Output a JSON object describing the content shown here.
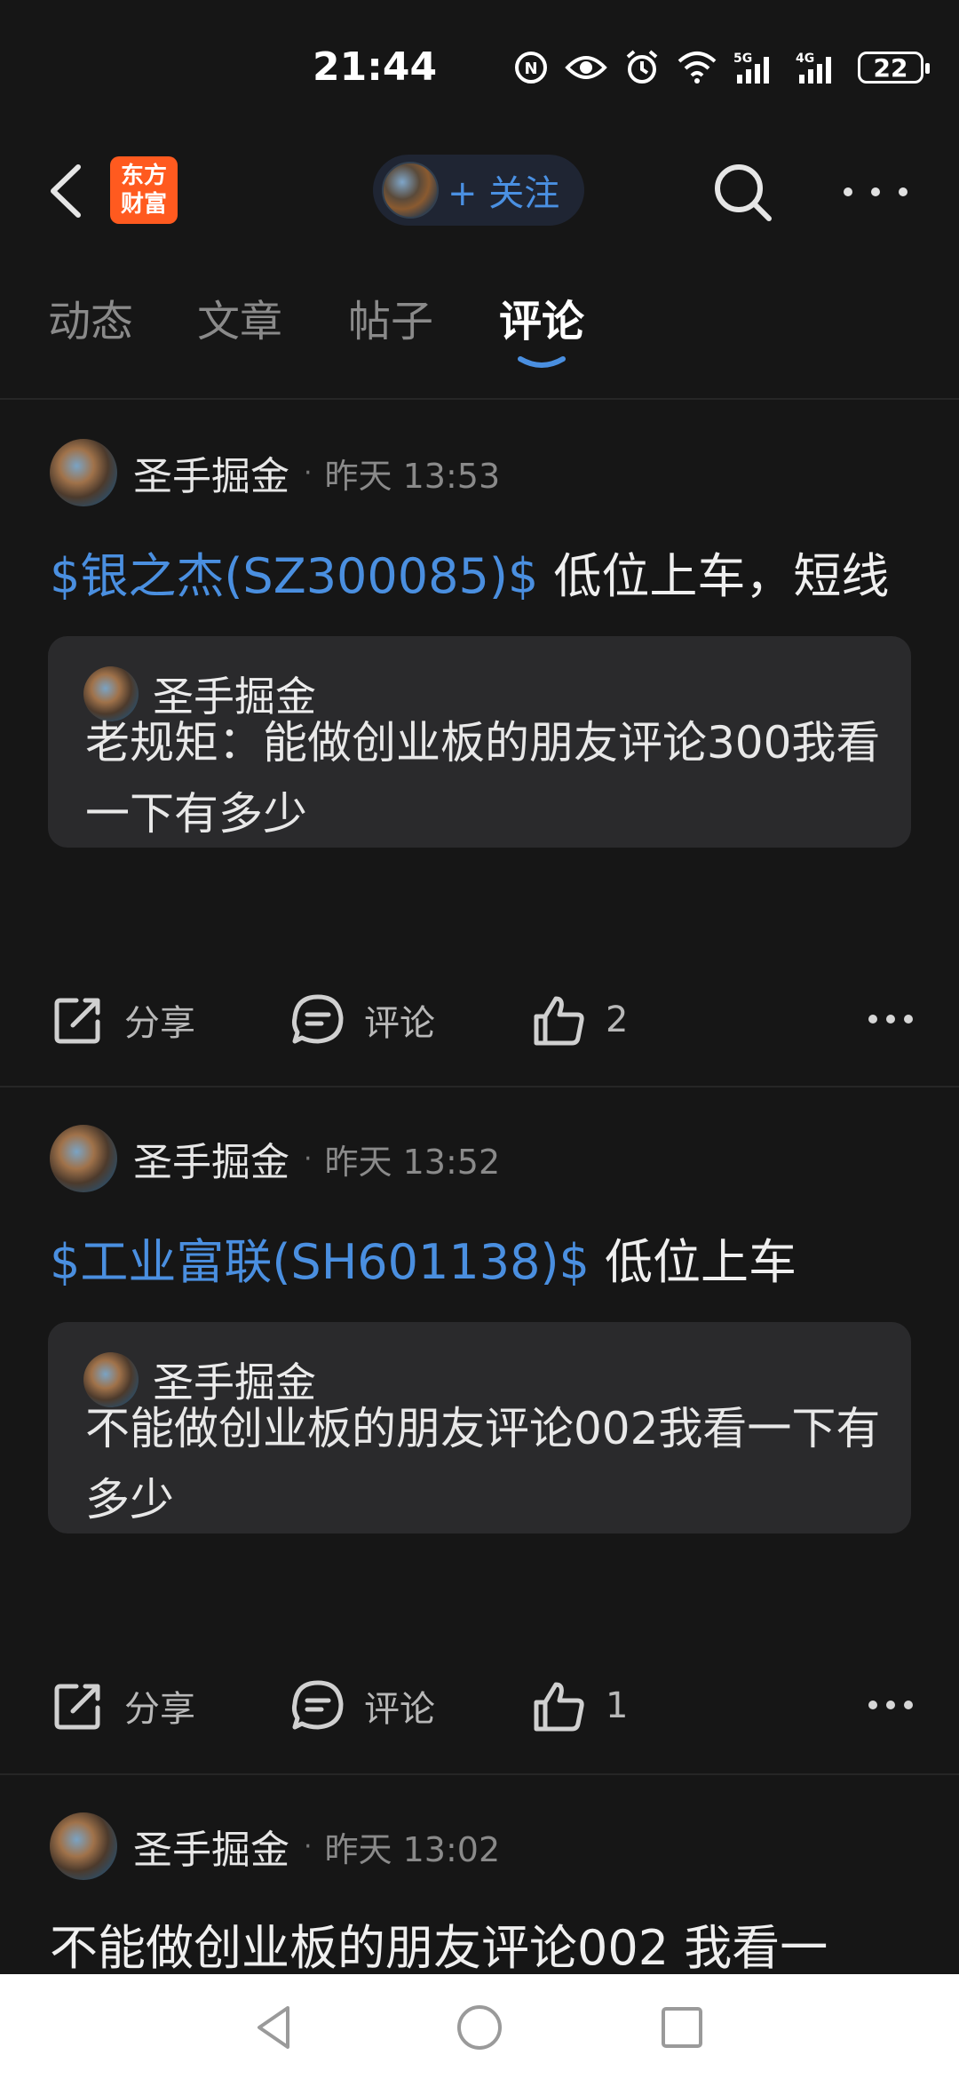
{
  "status": {
    "time": "21:44",
    "battery": "22",
    "net1": "5G",
    "net2": "4G"
  },
  "header": {
    "logo_text_line1": "东方",
    "logo_text_line2": "财富",
    "follow_label": "+ 关注"
  },
  "tabs": [
    {
      "label": "动态"
    },
    {
      "label": "文章"
    },
    {
      "label": "帖子"
    },
    {
      "label": "评论"
    }
  ],
  "active_tab": "评论",
  "posts": [
    {
      "author": "圣手掘金",
      "time": "昨天 13:53",
      "stock": "$银之杰(SZ300085)$",
      "text": " 低位上车，短线",
      "quote_author": "圣手掘金",
      "quote_text": "老规矩：能做创业板的朋友评论300我看一下有多少",
      "share_label": "分享",
      "comment_label": "评论",
      "like_count": "2"
    },
    {
      "author": "圣手掘金",
      "time": "昨天 13:52",
      "stock": "$工业富联(SH601138)$",
      "text": " 低位上车",
      "quote_author": "圣手掘金",
      "quote_text": "不能做创业板的朋友评论002我看一下有多少",
      "share_label": "分享",
      "comment_label": "评论",
      "like_count": "1"
    },
    {
      "author": "圣手掘金",
      "time": "昨天 13:02",
      "text": "不能做创业板的朋友评论002  我看一"
    }
  ],
  "colors": {
    "background": "#161616",
    "accent": "#4a8fe0",
    "logo": "#ff5a1f",
    "card": "#2a2a2c"
  }
}
